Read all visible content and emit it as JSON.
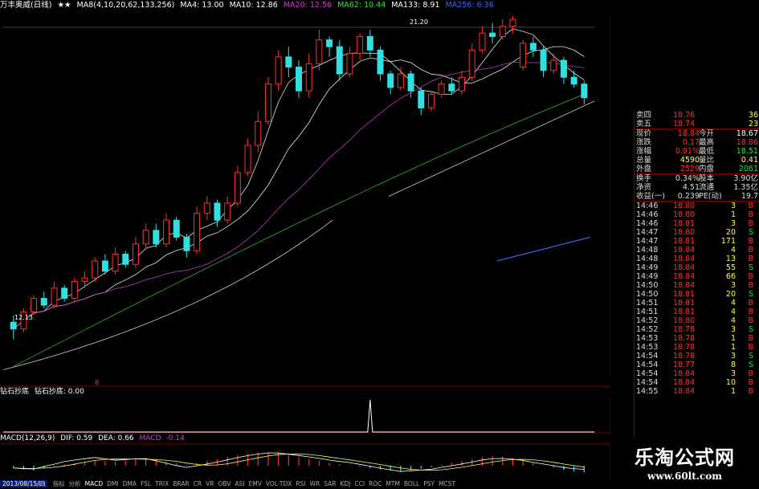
{
  "header": {
    "title": "万丰奥威(日线)",
    "stars": "★★",
    "ma_label": "MA8(4,10,20,62,133,256)",
    "ma_values": [
      {
        "label": "MA4: 13.00",
        "color": "#ffffff"
      },
      {
        "label": "MA10: 12.86",
        "color": "#ffffff"
      },
      {
        "label": "MA20: 12.56",
        "color": "#d040d0"
      },
      {
        "label": "MA62: 10.44",
        "color": "#40e040"
      },
      {
        "label": "MA133: 8.91",
        "color": "#ffffff"
      },
      {
        "label": "MA256: 6.36",
        "color": "#4060ff"
      }
    ]
  },
  "chart_data": [
    {
      "type": "candlestick",
      "title": "万丰奥威(日线)",
      "ylim": [
        11.0,
        21.6
      ],
      "y_ticks": [
        "21.00",
        "20.00",
        "19.00",
        "18.00",
        "17.00",
        "16.00",
        "15.00",
        "14.00",
        "13.00",
        "12.00",
        "11.00"
      ],
      "y_tick_values": [
        21,
        20,
        19,
        18,
        17,
        16,
        15,
        14,
        13,
        12,
        11
      ],
      "low_label": "12.13",
      "high_label": "21.20",
      "candles": [
        [
          12.6,
          12.4,
          12.8,
          12.1
        ],
        [
          12.4,
          12.9,
          13.0,
          12.3
        ],
        [
          12.9,
          13.3,
          13.4,
          12.8
        ],
        [
          13.3,
          13.1,
          13.5,
          13.0
        ],
        [
          13.1,
          13.6,
          13.8,
          13.0
        ],
        [
          13.6,
          13.3,
          13.7,
          13.2
        ],
        [
          13.3,
          13.8,
          13.9,
          13.2
        ],
        [
          13.8,
          13.9,
          14.1,
          13.6
        ],
        [
          13.9,
          14.4,
          14.5,
          13.8
        ],
        [
          14.4,
          14.1,
          14.6,
          14.0
        ],
        [
          14.1,
          14.6,
          14.8,
          14.0
        ],
        [
          14.6,
          14.3,
          14.7,
          14.2
        ],
        [
          14.3,
          14.9,
          15.1,
          14.2
        ],
        [
          14.9,
          15.3,
          15.5,
          14.8
        ],
        [
          15.3,
          14.9,
          15.5,
          14.8
        ],
        [
          14.9,
          15.6,
          15.8,
          14.8
        ],
        [
          15.6,
          15.1,
          15.7,
          15.0
        ],
        [
          15.1,
          14.7,
          15.2,
          14.5
        ],
        [
          14.7,
          15.8,
          16.0,
          14.6
        ],
        [
          15.8,
          16.1,
          16.3,
          15.6
        ],
        [
          16.1,
          15.6,
          16.2,
          15.4
        ],
        [
          15.6,
          16.1,
          16.3,
          15.5
        ],
        [
          16.1,
          17.0,
          17.2,
          16.0
        ],
        [
          17.0,
          17.8,
          18.0,
          16.9
        ],
        [
          17.8,
          18.5,
          18.8,
          17.6
        ],
        [
          18.5,
          19.6,
          19.8,
          18.4
        ],
        [
          19.6,
          20.4,
          20.6,
          19.4
        ],
        [
          20.4,
          20.1,
          20.7,
          19.8
        ],
        [
          20.1,
          19.4,
          20.3,
          19.2
        ],
        [
          19.4,
          20.2,
          20.5,
          19.2
        ],
        [
          20.2,
          20.9,
          21.2,
          20.0
        ],
        [
          20.9,
          20.7,
          21.0,
          20.4
        ],
        [
          20.7,
          19.9,
          20.9,
          19.7
        ],
        [
          19.9,
          20.5,
          20.7,
          19.8
        ],
        [
          20.5,
          21.0,
          21.1,
          20.3
        ],
        [
          21.0,
          20.6,
          21.2,
          20.4
        ],
        [
          20.6,
          19.9,
          20.7,
          19.7
        ],
        [
          19.9,
          19.5,
          20.0,
          19.3
        ],
        [
          19.5,
          19.9,
          20.1,
          19.4
        ],
        [
          19.9,
          19.4,
          20.0,
          19.2
        ],
        [
          19.4,
          18.9,
          19.5,
          18.7
        ],
        [
          18.9,
          19.3,
          19.4,
          18.8
        ],
        [
          19.3,
          19.6,
          19.7,
          19.2
        ],
        [
          19.6,
          19.4,
          19.8,
          19.3
        ],
        [
          19.4,
          19.8,
          20.0,
          19.3
        ],
        [
          19.8,
          20.6,
          20.8,
          19.7
        ],
        [
          20.6,
          21.1,
          21.3,
          20.5
        ],
        [
          21.1,
          21.0,
          21.4,
          20.8
        ],
        [
          21.0,
          21.3,
          21.5,
          20.9
        ],
        [
          21.3,
          21.5,
          21.6,
          21.1
        ],
        [
          20.1,
          20.8,
          20.9,
          20.0
        ],
        [
          20.8,
          20.6,
          21.0,
          20.4
        ],
        [
          20.6,
          20.0,
          20.7,
          19.8
        ],
        [
          20.0,
          20.3,
          20.5,
          19.9
        ],
        [
          20.3,
          19.8,
          20.4,
          19.6
        ],
        [
          19.8,
          19.6,
          20.0,
          19.5
        ],
        [
          19.6,
          19.2,
          19.7,
          19.0
        ]
      ],
      "volume_marker": "8"
    },
    {
      "type": "line",
      "title": "钻石抄底",
      "y_ticks": [
        "1.00",
        "0.50",
        "0.00"
      ],
      "y_tick_values": [
        1,
        0.5,
        0
      ],
      "spike_index": 35,
      "spike_value": 1.0
    },
    {
      "type": "bar",
      "title": "MACD(12,26,9)",
      "y_ticks": [
        "0.00"
      ],
      "values": [
        -0.05,
        -0.08,
        -0.1,
        -0.06,
        -0.02,
        0.03,
        0.06,
        0.09,
        0.12,
        0.1,
        0.08,
        0.11,
        0.14,
        0.16,
        0.13,
        0.09,
        0.05,
        0.02,
        0.06,
        0.1,
        0.14,
        0.18,
        0.22,
        0.25,
        0.27,
        0.28,
        0.26,
        0.22,
        0.18,
        0.14,
        0.1,
        0.06,
        0.03,
        0.01,
        -0.02,
        -0.05,
        -0.08,
        -0.1,
        -0.12,
        -0.09,
        -0.06,
        -0.03,
        0.02,
        0.06,
        0.1,
        0.14,
        0.18,
        0.2,
        0.19,
        0.16,
        0.12,
        0.06,
        0.01,
        -0.04,
        -0.09,
        -0.12,
        -0.14
      ]
    }
  ],
  "indicator": {
    "title": "钻石抄底",
    "label": "钻石抄底: 0.00"
  },
  "macd": {
    "title": "MACD(12,26,9)",
    "dif": "DIF: 0.59",
    "dea": "DEA: 0.66",
    "macd": "MACD: -0.14"
  },
  "bottom": {
    "date": "2013/08/15/四",
    "tabs": [
      "指标",
      "分析",
      "MACD",
      "DMI",
      "DMA",
      "FSL",
      "TRIX",
      "BRAR",
      "CR",
      "VR",
      "OBV",
      "ASI",
      "EMV",
      "VOL-TDX",
      "RSI",
      "WR",
      "SAR",
      "KDJ",
      "CCI",
      "ROC",
      "MTM",
      "BOLL",
      "PSY",
      "MCST"
    ]
  },
  "quote": {
    "bid_ask": [
      {
        "label": "卖四",
        "price": "18.76",
        "vol": "36"
      },
      {
        "label": "卖五",
        "price": "18.74",
        "vol": "23"
      }
    ],
    "stats": [
      {
        "l1": "现价",
        "v1": "18.84",
        "l2": "今开",
        "v2": "18.67",
        "c1": "#ff3030",
        "c2": "#ffffff"
      },
      {
        "l1": "涨跌",
        "v1": "0.17",
        "l2": "最高",
        "v2": "18.86",
        "c1": "#ff3030",
        "c2": "#ff3030"
      },
      {
        "l1": "涨幅",
        "v1": "0.91%",
        "l2": "最低",
        "v2": "18.51",
        "c1": "#ff3030",
        "c2": "#30e030"
      },
      {
        "l1": "总量",
        "v1": "4590",
        "l2": "量比",
        "v2": "0.41",
        "c1": "#ffff40",
        "c2": "#ffff40"
      },
      {
        "l1": "外盘",
        "v1": "2529",
        "l2": "内盘",
        "v2": "2061",
        "c1": "#ff3030",
        "c2": "#30e030"
      }
    ],
    "stats2": [
      {
        "l1": "换手",
        "v1": "0.34%",
        "l2": "股本",
        "v2": "3.90亿"
      },
      {
        "l1": "净资",
        "v1": "4.51",
        "l2": "流通",
        "v2": "1.35亿"
      },
      {
        "l1": "收益(一)",
        "v1": "0.239",
        "l2": "PE(动)",
        "v2": "19.7"
      }
    ],
    "ticks": [
      {
        "time": "14:46",
        "price": "18.80",
        "vol": "3",
        "side": "B"
      },
      {
        "time": "14:46",
        "price": "18.80",
        "vol": "1",
        "side": "B"
      },
      {
        "time": "14:46",
        "price": "18.81",
        "vol": "3",
        "side": "B"
      },
      {
        "time": "14:47",
        "price": "18.80",
        "vol": "20",
        "side": "S"
      },
      {
        "time": "14:47",
        "price": "18.81",
        "vol": "171",
        "side": "B"
      },
      {
        "time": "14:48",
        "price": "18.84",
        "vol": "4",
        "side": "B"
      },
      {
        "time": "14:48",
        "price": "18.84",
        "vol": "13",
        "side": "B"
      },
      {
        "time": "14:49",
        "price": "18.84",
        "vol": "55",
        "side": "S"
      },
      {
        "time": "14:49",
        "price": "18.84",
        "vol": "66",
        "side": "B"
      },
      {
        "time": "14:50",
        "price": "18.84",
        "vol": "3",
        "side": "B"
      },
      {
        "time": "14:50",
        "price": "18.81",
        "vol": "20",
        "side": "S"
      },
      {
        "time": "14:51",
        "price": "18.81",
        "vol": "4",
        "side": "B"
      },
      {
        "time": "14:51",
        "price": "18.81",
        "vol": "4",
        "side": "B"
      },
      {
        "time": "14:52",
        "price": "18.80",
        "vol": "4",
        "side": "B"
      },
      {
        "time": "14:52",
        "price": "18.78",
        "vol": "3",
        "side": "S"
      },
      {
        "time": "14:53",
        "price": "18.78",
        "vol": "1",
        "side": "B"
      },
      {
        "time": "14:53",
        "price": "18.78",
        "vol": "1",
        "side": "B"
      },
      {
        "time": "14:54",
        "price": "18.78",
        "vol": "3",
        "side": "S"
      },
      {
        "time": "14:54",
        "price": "18.77",
        "vol": "8",
        "side": "S"
      },
      {
        "time": "14:54",
        "price": "18.84",
        "vol": "3",
        "side": "B"
      },
      {
        "time": "14:54",
        "price": "18.84",
        "vol": "10",
        "side": "B"
      },
      {
        "time": "14:55",
        "price": "18.84",
        "vol": "1",
        "side": "B"
      }
    ]
  },
  "watermark": {
    "cn": "乐淘公式网",
    "url": "www.60lt.com"
  },
  "colors": {
    "up": "#ff3030",
    "down": "#30e0e0",
    "grid": "#7a0000",
    "ma_white": "#ffffff",
    "ma_purple": "#d040d0",
    "ma_green": "#40e040",
    "ma_blue": "#4060ff"
  }
}
